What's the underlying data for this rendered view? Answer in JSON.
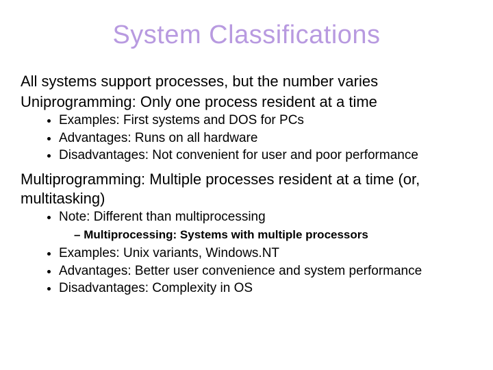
{
  "title": "System  Classifications",
  "intro": "All systems support processes, but the number varies",
  "uni": {
    "heading": "Uniprogramming: Only one process resident at a time",
    "items": [
      "Examples: First systems and DOS for PCs",
      "Advantages: Runs on all hardware",
      "Disadvantages: Not convenient for user and poor performance"
    ]
  },
  "multi": {
    "heading": "Multiprogramming: Multiple processes resident at a time (or, multitasking)",
    "note": "Note: Different than multiprocessing",
    "note_sub": "Multiprocessing: Systems with multiple processors",
    "items": [
      "Examples: Unix variants, Windows.NT",
      "Advantages: Better user convenience and system performance",
      "Disadvantages: Complexity in OS"
    ]
  }
}
